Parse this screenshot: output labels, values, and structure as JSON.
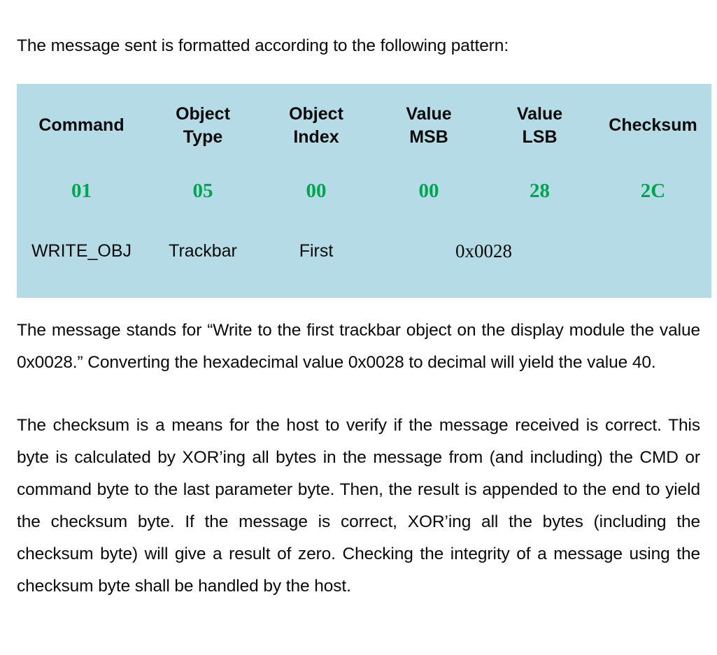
{
  "document": {
    "intro_paragraph": "The message sent is formatted according to the following pattern:",
    "paragraph_meaning": "The message stands for “Write to the first trackbar object on the display module the value 0x0028.” Converting the hexadecimal value 0x0028 to decimal will yield the value 40.",
    "paragraph_checksum": "The checksum is a means for the host to verify if the message received is correct. This byte is calculated by XOR’ing all bytes in the message from (and including) the CMD or command byte to the last parameter byte. Then, the result is appended to the end to yield the checksum byte. If the message is correct, XOR’ing all the bytes (including the checksum byte) will give a result of zero. Checking the integrity of a message using the checksum byte shall be handled by the host."
  },
  "colors": {
    "table_background": "#b5dce6",
    "hex_value_green": "#00a550",
    "text_black": "#0a0a0a",
    "page_background": "#ffffff"
  },
  "protocol_table": {
    "headers": [
      {
        "line1": "Command",
        "line2": ""
      },
      {
        "line1": "Object",
        "line2": "Type"
      },
      {
        "line1": "Object",
        "line2": "Index"
      },
      {
        "line1": "Value",
        "line2": "MSB"
      },
      {
        "line1": "Value",
        "line2": "LSB"
      },
      {
        "line1": "Checksum",
        "line2": ""
      }
    ],
    "hex_values": [
      "01",
      "05",
      "00",
      "00",
      "28",
      "2C"
    ],
    "descriptions": {
      "command": "WRITE_OBJ",
      "object_type": "Trackbar",
      "object_index": "First",
      "value_combined": "0x0028",
      "checksum": ""
    }
  }
}
